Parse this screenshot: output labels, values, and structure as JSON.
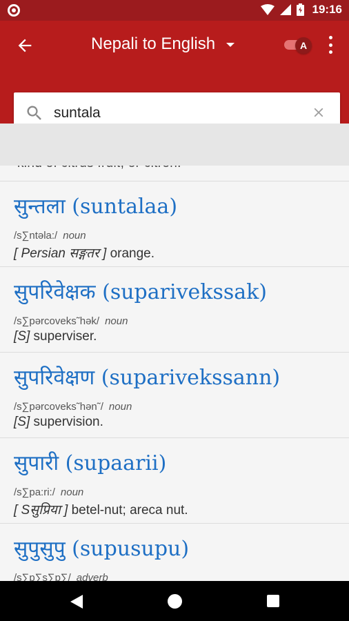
{
  "status_bar": {
    "time": "19:16",
    "icons": [
      "record-icon",
      "wifi-icon",
      "signal-icon",
      "battery-icon"
    ]
  },
  "app_bar": {
    "title": "Nepali to English",
    "back_icon": "arrow-left-icon",
    "toggle_label": "A",
    "more_icon": "more-vert-icon"
  },
  "search": {
    "value": "suntala",
    "search_icon": "search-icon",
    "clear_icon": "close-icon"
  },
  "results": {
    "partial_text": "kind of citrus fruit, or citron.",
    "entries": [
      {
        "headword": "सुन्तला (suntalaa)",
        "pron": "/s∑ntəla:/",
        "pos": "noun",
        "etymology": "[ Persian सङ्गतर ]",
        "definition": "orange."
      },
      {
        "headword": "सुपरिवेक्षक (suparivekssak)",
        "pron": "/s∑pərcoveks˜hək/",
        "pos": "noun",
        "etymology": "[S]",
        "definition": "superviser."
      },
      {
        "headword": "सुपरिवेक्षण (suparivekssann)",
        "pron": "/s∑pərcoveks˜hən˜/",
        "pos": "noun",
        "etymology": "[S]",
        "definition": "supervision."
      },
      {
        "headword": "सुपारी (supaarii)",
        "pron": "/s∑pa:ri:/",
        "pos": "noun",
        "etymology": "[ Sसुप्रिया ]",
        "definition": "betel-nut; areca nut."
      },
      {
        "headword": "सुपुसुपु (supusupu)",
        "pron": "/s∑p∑s∑p∑/",
        "pos": "adverb",
        "etymology": "",
        "definition": ""
      }
    ]
  },
  "nav_bar": {
    "icons": [
      "nav-back-icon",
      "nav-home-icon",
      "nav-recents-icon"
    ]
  },
  "colors": {
    "status_bar": "#9b1b1e",
    "app_bar": "#b71c1c",
    "headword": "#1e6fc4"
  }
}
